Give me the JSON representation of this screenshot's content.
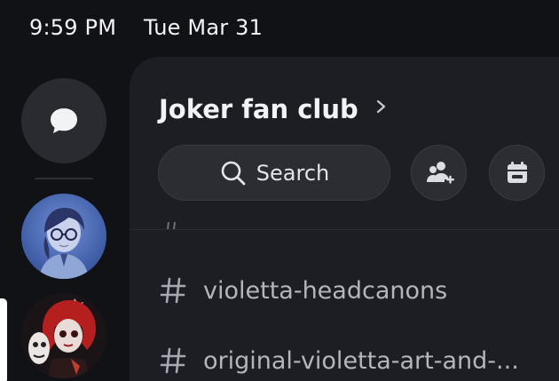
{
  "status_bar": {
    "time": "9:59 PM",
    "date": "Tue Mar 31"
  },
  "rail": {
    "dm_icon": "chat-bubble-icon",
    "servers": [
      {
        "name": "server-avatar-portrait-glasses"
      },
      {
        "name": "server-avatar-red-hair-art",
        "selected": true
      }
    ]
  },
  "guild": {
    "name": "Joker fan club",
    "chevron_icon": "chevron-right-icon"
  },
  "toolbar": {
    "search_label": "Search",
    "search_icon": "search-icon",
    "invite_icon": "add-member-icon",
    "events_icon": "calendar-icon"
  },
  "channels": [
    {
      "name": "violetta-headcanons",
      "icon": "hash-icon"
    },
    {
      "name": "original-violetta-art-and-...",
      "icon": "hash-icon"
    }
  ],
  "colors": {
    "background": "#111216",
    "panel": "#1d1e23",
    "button": "#2c2d33",
    "text_primary": "#f2f3f5",
    "text_muted": "#b4b6bc"
  }
}
